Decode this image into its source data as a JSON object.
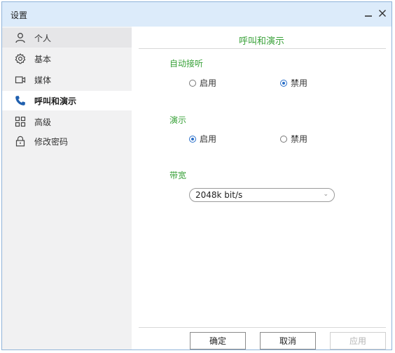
{
  "window": {
    "title": "设置"
  },
  "sidebar": {
    "items": [
      {
        "label": "个人",
        "icon": "person-icon"
      },
      {
        "label": "基本",
        "icon": "gear-icon"
      },
      {
        "label": "媒体",
        "icon": "camera-icon"
      },
      {
        "label": "呼叫和演示",
        "icon": "phone-icon"
      },
      {
        "label": "高级",
        "icon": "grid-icon"
      },
      {
        "label": "修改密码",
        "icon": "lock-icon"
      }
    ]
  },
  "main": {
    "title": "呼叫和演示",
    "auto_answer": {
      "label": "自动接听",
      "enable": "启用",
      "disable": "禁用",
      "selected": "禁用"
    },
    "presentation": {
      "label": "演示",
      "enable": "启用",
      "disable": "禁用",
      "selected": "启用"
    },
    "bandwidth": {
      "label": "带宽",
      "value": "2048k bit/s"
    }
  },
  "footer": {
    "ok": "确定",
    "cancel": "取消",
    "apply": "应用"
  },
  "colors": {
    "accent_green": "#3aa23a",
    "titlebar": "#dcebfa",
    "radio_blue": "#2a6fc9"
  }
}
